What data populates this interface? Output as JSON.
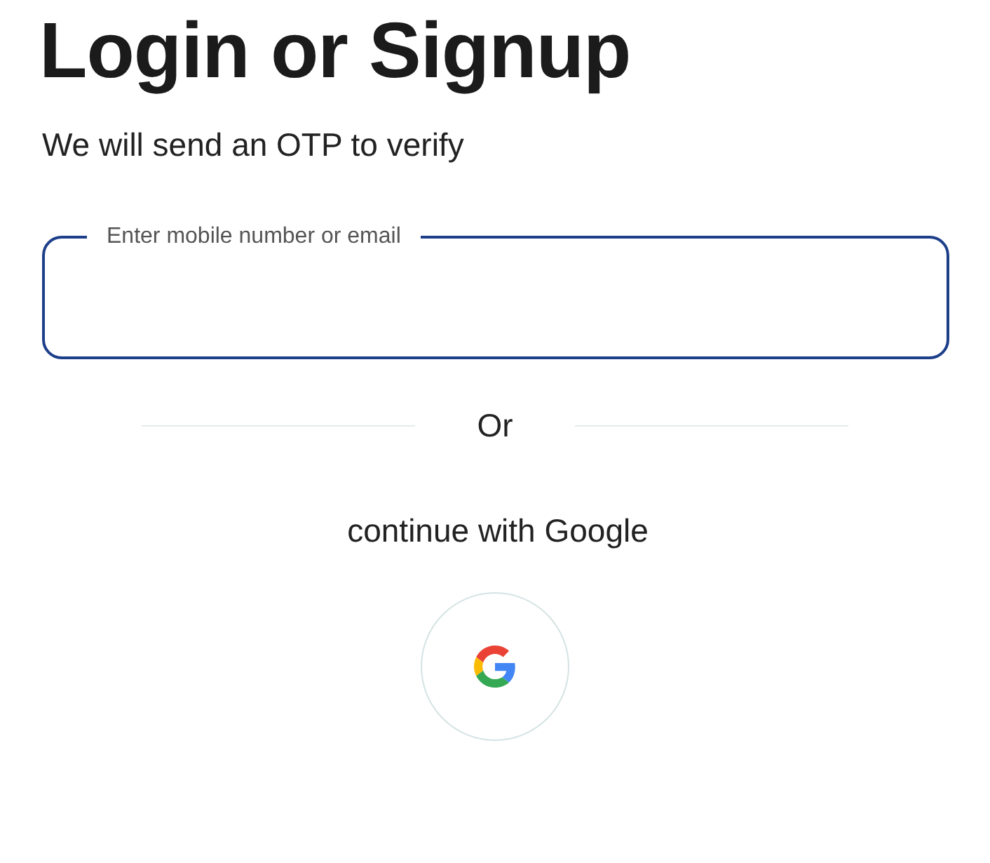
{
  "title": "Login or Signup",
  "subtitle": "We will send an OTP to verify",
  "field": {
    "placeholder": "Enter mobile number or email"
  },
  "divider": {
    "label": "Or"
  },
  "social": {
    "label": "continue with Google"
  }
}
